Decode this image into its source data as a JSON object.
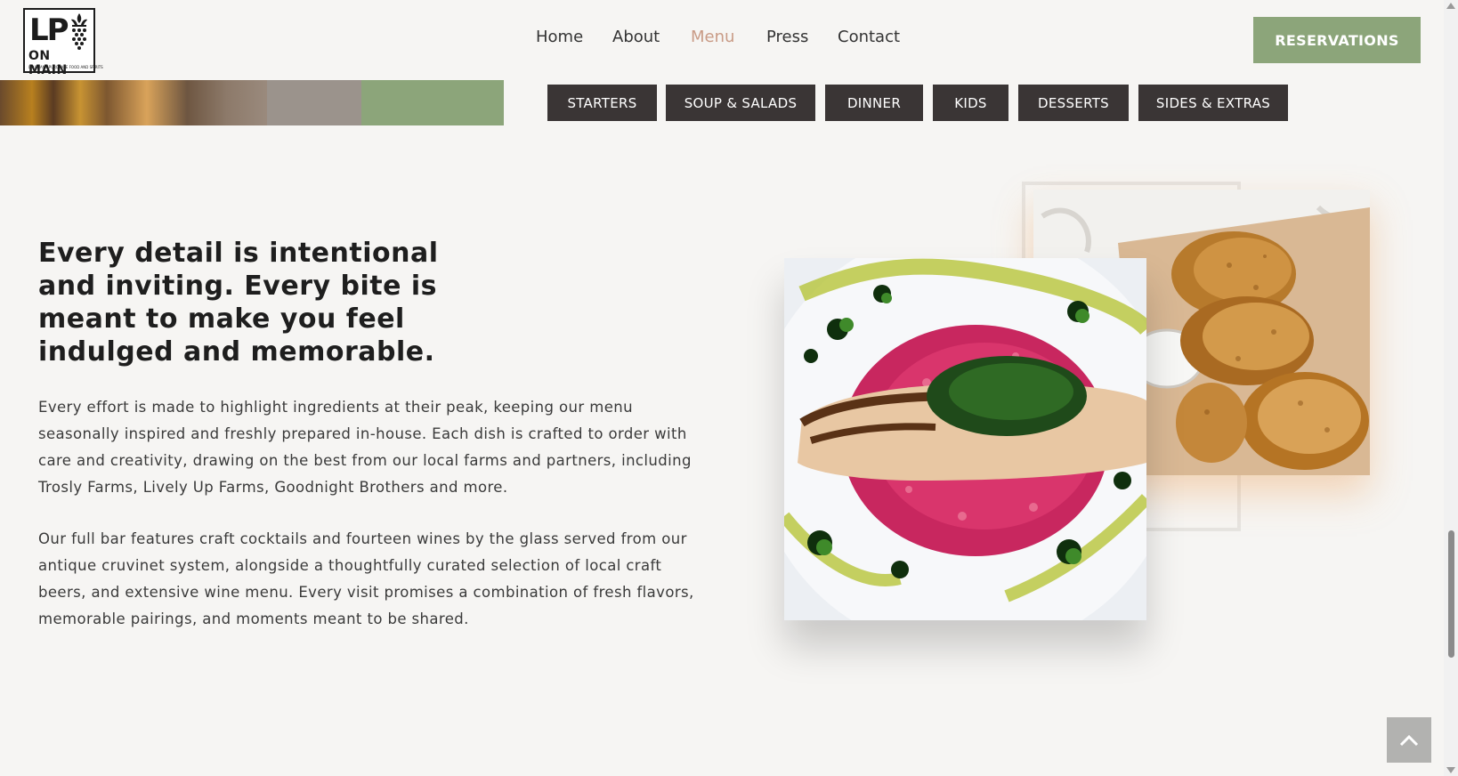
{
  "logo": {
    "line1": "LP",
    "line2": "ON MAIN",
    "tagline": "LOUISIANA PURCHASE FOOD AND SPIRITS"
  },
  "nav": {
    "items": [
      {
        "label": "Home"
      },
      {
        "label": "About"
      },
      {
        "label": "Menu"
      },
      {
        "label": "Press"
      },
      {
        "label": "Contact"
      }
    ],
    "active": "Menu",
    "active_color": "#c99b86"
  },
  "reservations_label": "RESERVATIONS",
  "menu_tabs": [
    {
      "label": "STARTERS"
    },
    {
      "label": "SOUP & SALADS"
    },
    {
      "label": "DINNER"
    },
    {
      "label": "KIDS"
    },
    {
      "label": "DESSERTS"
    },
    {
      "label": "SIDES & EXTRAS"
    }
  ],
  "content": {
    "headline": "Every detail is intentional and inviting. Every bite is meant to make you feel indulged and memorable.",
    "paragraph1": "Every effort is made to highlight ingredients at their peak, keeping our menu seasonally inspired and freshly prepared in-house. Each dish is crafted to order with care and creativity, drawing on the best from our local farms and partners, including Trosly Farms, Lively Up Farms, Goodnight Brothers and more.",
    "paragraph2": "Our full bar features craft cocktails and fourteen wines by the glass served from our antique cruvinet system, alongside a thoughtfully curated selection of local craft beers, and extensive wine menu. Every visit promises a combination of fresh flavors, memorable pairings, and moments meant to be shared."
  },
  "colors": {
    "accent_green": "#8ca57a",
    "tab_dark": "#3a3535",
    "background": "#f6f5f3"
  },
  "icons": {
    "back_to_top": "chevron-up-icon"
  }
}
